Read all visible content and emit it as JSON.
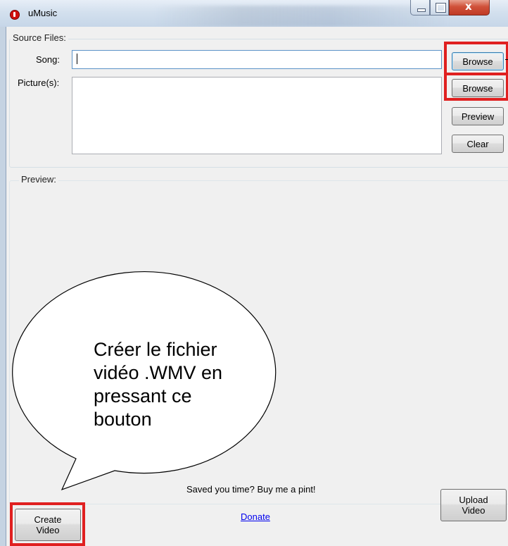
{
  "window": {
    "title": "uMusic",
    "close_glyph": "x"
  },
  "source_files": {
    "group_label": "Source Files:",
    "song_label": "Song:",
    "song_value": "",
    "pictures_label": "Picture(s):",
    "browse_song_label": "Browse",
    "browse_pictures_label": "Browse",
    "preview_label": "Preview",
    "clear_label": "Clear"
  },
  "preview": {
    "group_label": "Preview:"
  },
  "footer": {
    "create_video_line1": "Create",
    "create_video_line2": "Video",
    "promo_text": "Saved you time? Buy me a pint!",
    "donate_label": "Donate",
    "upload_video_line1": "Upload",
    "upload_video_line2": "Video"
  },
  "callout": {
    "lines": [
      "Créer le fichier",
      "vidéo .WMV en",
      "pressant ce",
      "bouton"
    ]
  },
  "colors": {
    "highlight": "#e02020",
    "link": "#0000ee",
    "window_bg": "#f0f0f0"
  }
}
